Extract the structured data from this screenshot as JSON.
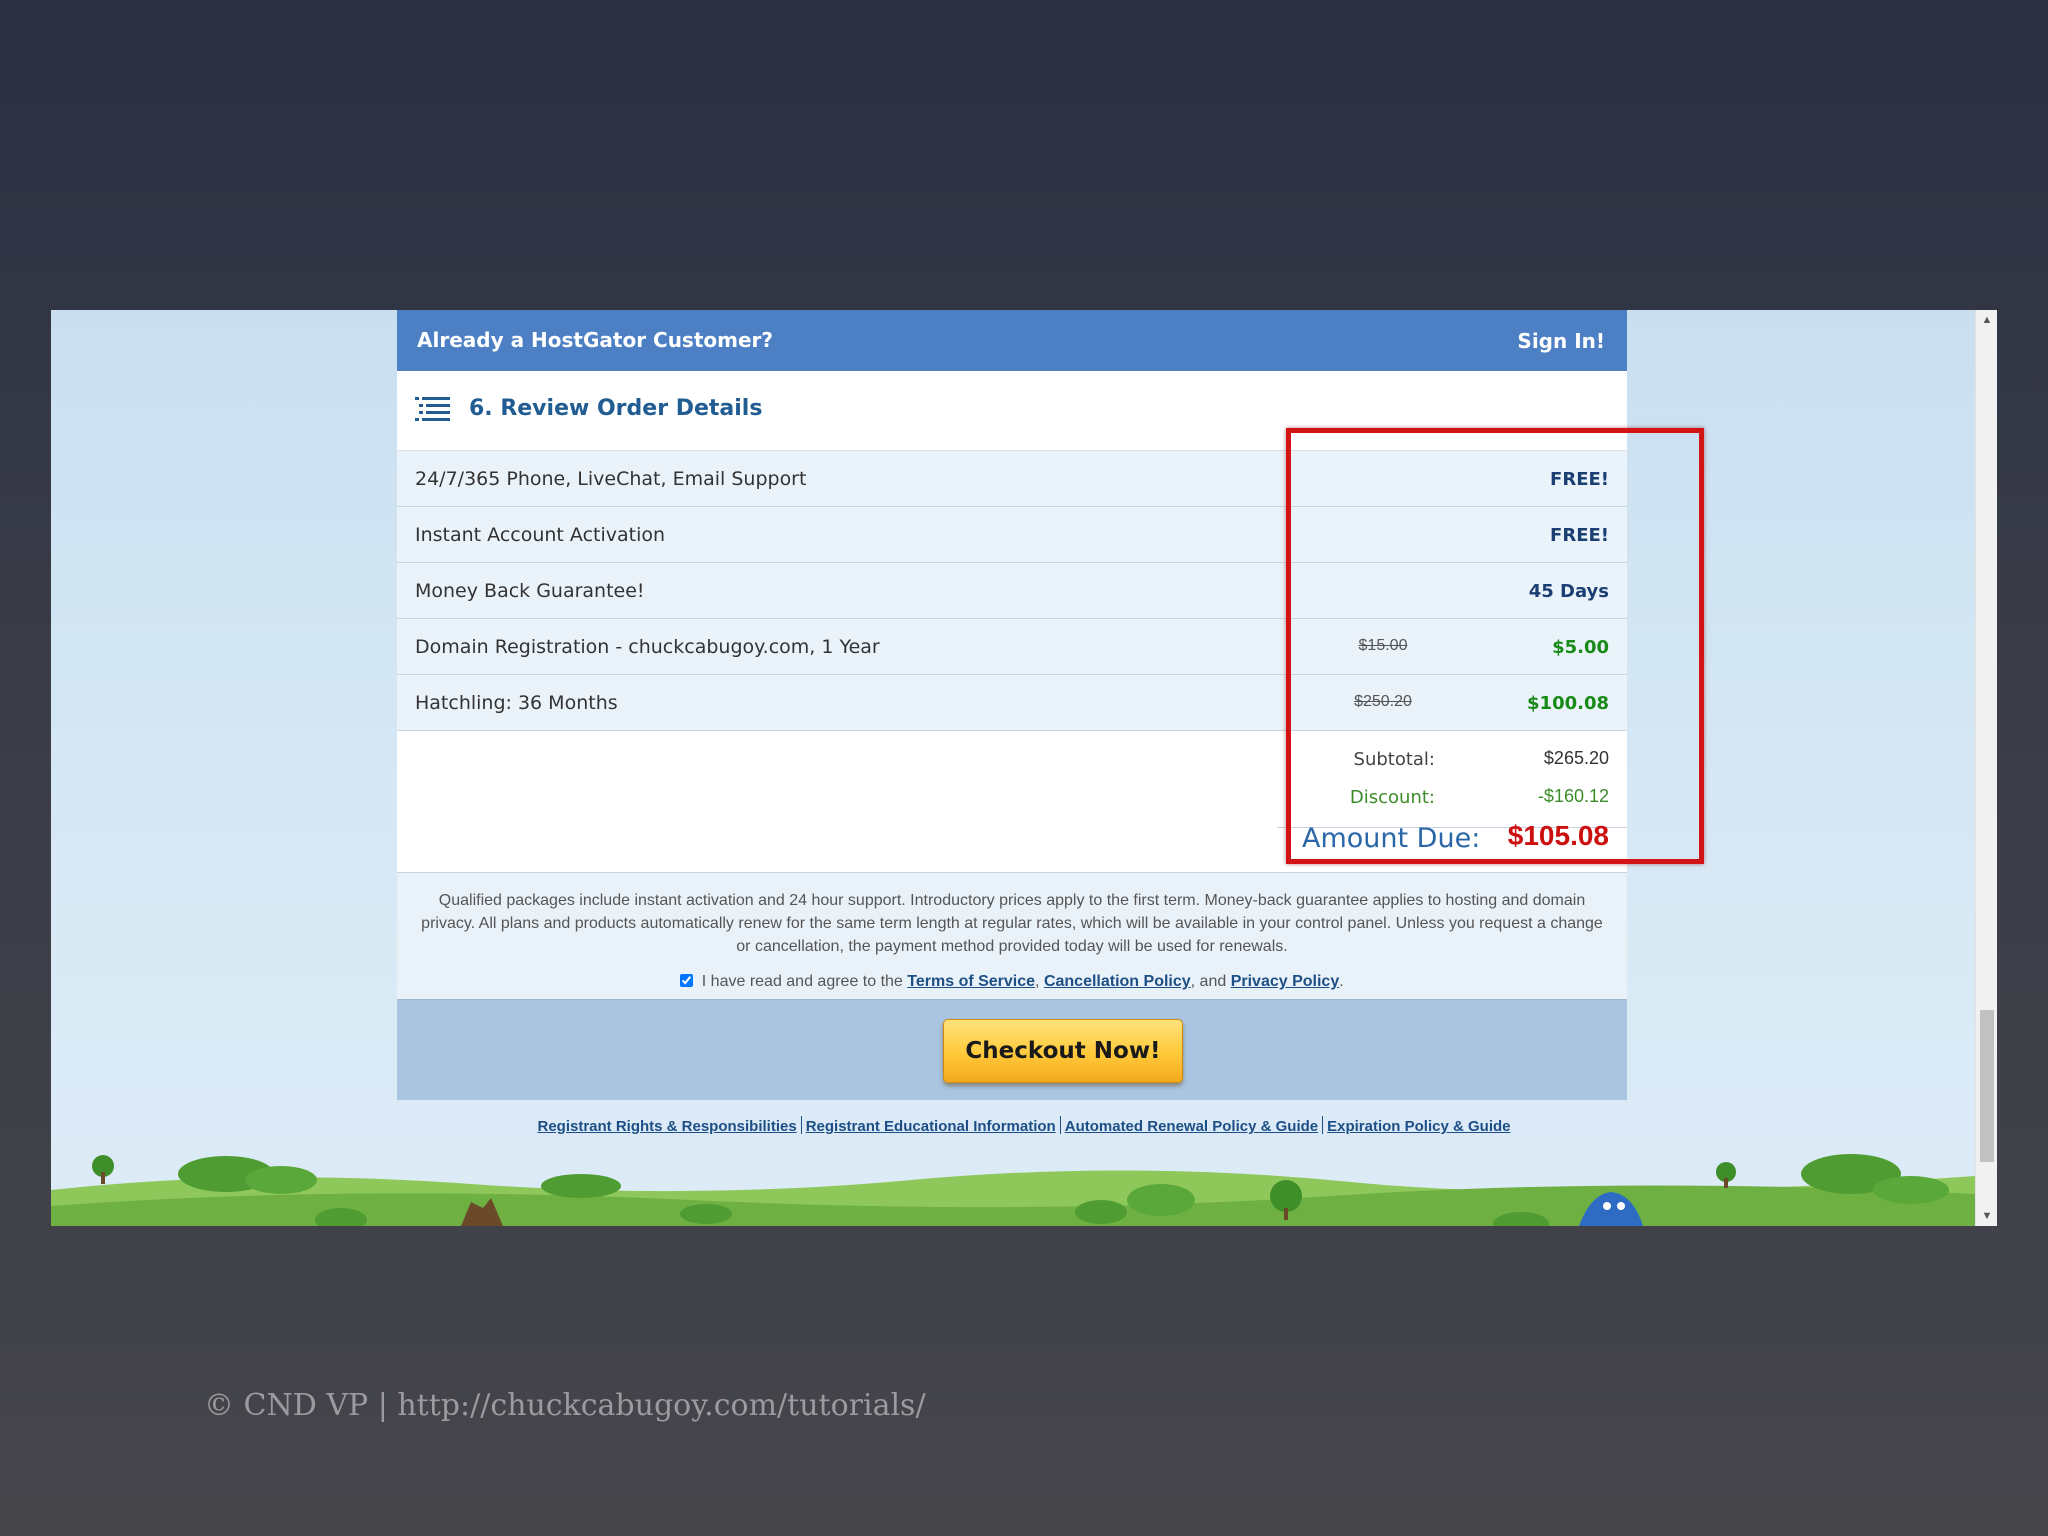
{
  "signin_bar": {
    "question": "Already a HostGator Customer?",
    "link": "Sign In!"
  },
  "review": {
    "title": "6. Review Order Details"
  },
  "order_items": [
    {
      "label": "24/7/365 Phone, LiveChat, Email Support",
      "original": "",
      "value": "FREE!",
      "green": false
    },
    {
      "label": "Instant Account Activation",
      "original": "",
      "value": "FREE!",
      "green": false
    },
    {
      "label": "Money Back Guarantee!",
      "original": "",
      "value": "45 Days",
      "green": false
    },
    {
      "label": "Domain Registration - chuckcabugoy.com, 1 Year",
      "original": "$15.00",
      "value": "$5.00",
      "green": true
    },
    {
      "label": "Hatchling: 36 Months",
      "original": "$250.20",
      "value": "$100.08",
      "green": true
    }
  ],
  "totals": {
    "subtotal_label": "Subtotal:",
    "subtotal_value": "$265.20",
    "discount_label": "Discount:",
    "discount_value": "-$160.12",
    "due_label": "Amount Due:",
    "due_value": "$105.08"
  },
  "fine_print": "Qualified packages include instant activation and 24 hour support. Introductory prices apply to the first term. Money-back guarantee applies to hosting and domain privacy. All plans and products automatically renew for the same term length at regular rates, which will be available in your control panel. Unless you request a change or cancellation, the payment method provided today will be used for renewals.",
  "agree": {
    "prefix": "I have read and agree to the",
    "tos": "Terms of Service",
    "cancellation": "Cancellation Policy",
    "and": ", and",
    "privacy": "Privacy Policy",
    "checked": true
  },
  "checkout_label": "Checkout Now!",
  "footer_links": [
    "Registrant Rights & Responsibilities",
    "Registrant Educational Information",
    "Automated Renewal Policy & Guide",
    "Expiration Policy & Guide"
  ],
  "caption": "© CND VP | http://chuckcabugoy.com/tutorials/",
  "colors": {
    "header_blue": "#4c7fc4",
    "highlight_red": "#d21414",
    "amount_due_red": "#cc0f0f",
    "price_green": "#178a17"
  }
}
